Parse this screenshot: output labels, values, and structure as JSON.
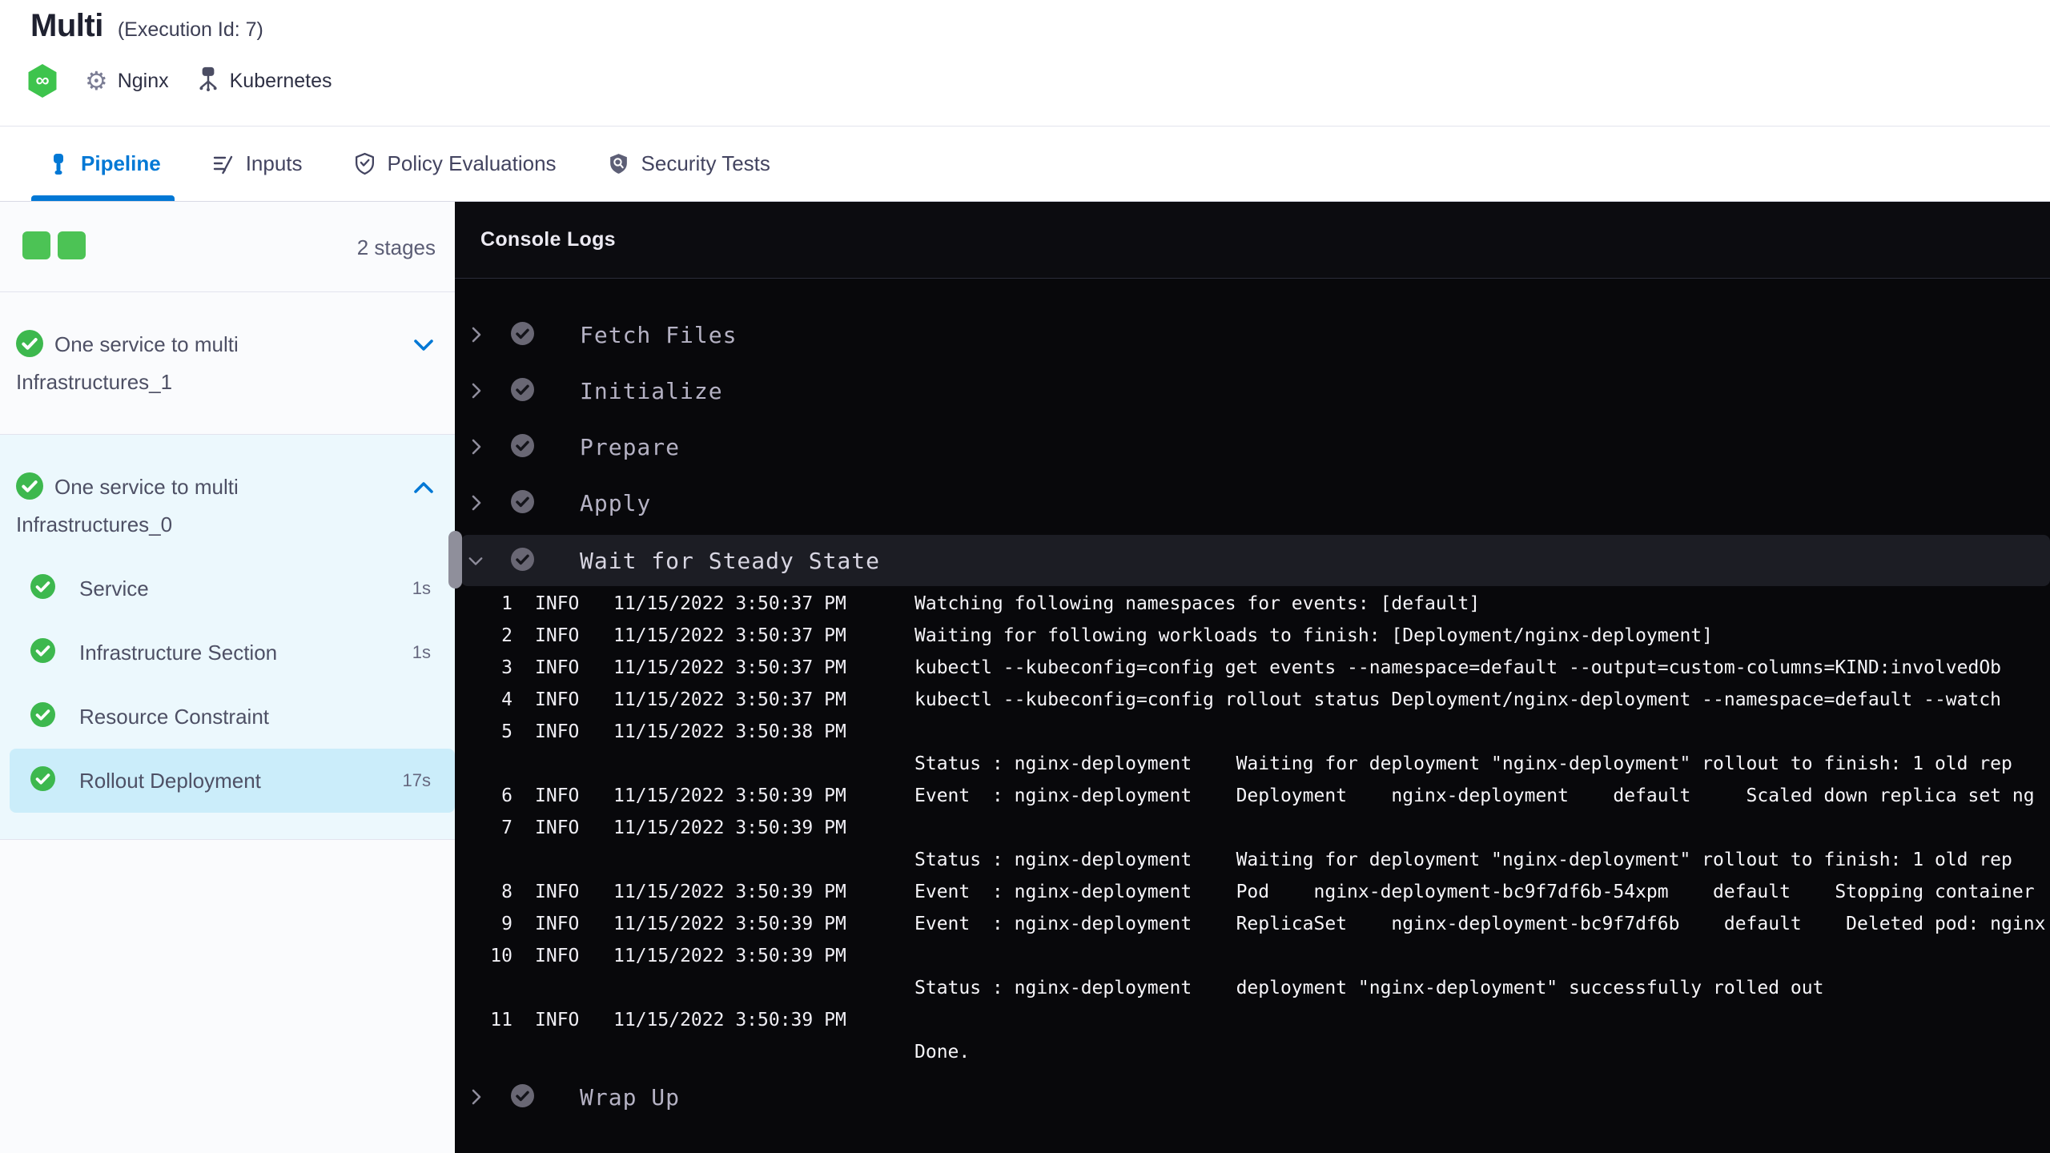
{
  "header": {
    "title": "Multi",
    "execution_label": "(Execution Id: 7)",
    "service_tag": "Nginx",
    "infra_tag": "Kubernetes"
  },
  "tabs": [
    {
      "label": "Pipeline",
      "icon": "pipeline-icon",
      "active": true
    },
    {
      "label": "Inputs",
      "icon": "inputs-icon",
      "active": false
    },
    {
      "label": "Policy Evaluations",
      "icon": "policy-shield-icon",
      "active": false
    },
    {
      "label": "Security Tests",
      "icon": "security-shield-icon",
      "active": false
    }
  ],
  "sidebar": {
    "stage_count_label": "2 stages",
    "stages": [
      {
        "name": "One service to multi Infrastructures_1",
        "status": "success",
        "expanded": false
      },
      {
        "name": "One service to multi Infrastructures_0",
        "status": "success",
        "expanded": true,
        "steps": [
          {
            "name": "Service",
            "duration": "1s",
            "status": "success",
            "selected": false
          },
          {
            "name": "Infrastructure Section",
            "duration": "1s",
            "status": "success",
            "selected": false
          },
          {
            "name": "Resource Constraint",
            "duration": "",
            "status": "success",
            "selected": false
          },
          {
            "name": "Rollout Deployment",
            "duration": "17s",
            "status": "success",
            "selected": true
          }
        ]
      }
    ]
  },
  "console": {
    "title": "Console Logs",
    "steps": [
      {
        "name": "Fetch Files",
        "state": "collapsed",
        "status": "success"
      },
      {
        "name": "Initialize",
        "state": "collapsed",
        "status": "success"
      },
      {
        "name": "Prepare",
        "state": "collapsed",
        "status": "success"
      },
      {
        "name": "Apply",
        "state": "collapsed",
        "status": "success"
      },
      {
        "name": "Wait for Steady State",
        "state": "expanded",
        "status": "success"
      },
      {
        "name": "Wrap Up",
        "state": "collapsed",
        "status": "success"
      }
    ],
    "logs": [
      {
        "num": "1",
        "level": "INFO",
        "time": "11/15/2022 3:50:37 PM",
        "msg": "Watching following namespaces for events: [default]"
      },
      {
        "num": "2",
        "level": "INFO",
        "time": "11/15/2022 3:50:37 PM",
        "msg": "Waiting for following workloads to finish: [Deployment/nginx-deployment]"
      },
      {
        "num": "3",
        "level": "INFO",
        "time": "11/15/2022 3:50:37 PM",
        "msg": "kubectl --kubeconfig=config get events --namespace=default --output=custom-columns=KIND:involvedOb"
      },
      {
        "num": "4",
        "level": "INFO",
        "time": "11/15/2022 3:50:37 PM",
        "msg": "kubectl --kubeconfig=config rollout status Deployment/nginx-deployment --namespace=default --watch"
      },
      {
        "num": "5",
        "level": "INFO",
        "time": "11/15/2022 3:50:38 PM",
        "msg": ""
      },
      {
        "num": "",
        "level": "",
        "time": "",
        "msg": "Status : nginx-deployment    Waiting for deployment \"nginx-deployment\" rollout to finish: 1 old rep"
      },
      {
        "num": "6",
        "level": "INFO",
        "time": "11/15/2022 3:50:39 PM",
        "msg": "Event  : nginx-deployment    Deployment    nginx-deployment    default     Scaled down replica set ng"
      },
      {
        "num": "7",
        "level": "INFO",
        "time": "11/15/2022 3:50:39 PM",
        "msg": ""
      },
      {
        "num": "",
        "level": "",
        "time": "",
        "msg": "Status : nginx-deployment    Waiting for deployment \"nginx-deployment\" rollout to finish: 1 old rep"
      },
      {
        "num": "8",
        "level": "INFO",
        "time": "11/15/2022 3:50:39 PM",
        "msg": "Event  : nginx-deployment    Pod    nginx-deployment-bc9f7df6b-54xpm    default    Stopping container"
      },
      {
        "num": "9",
        "level": "INFO",
        "time": "11/15/2022 3:50:39 PM",
        "msg": "Event  : nginx-deployment    ReplicaSet    nginx-deployment-bc9f7df6b    default    Deleted pod: nginx"
      },
      {
        "num": "10",
        "level": "INFO",
        "time": "11/15/2022 3:50:39 PM",
        "msg": ""
      },
      {
        "num": "",
        "level": "",
        "time": "",
        "msg": "Status : nginx-deployment    deployment \"nginx-deployment\" successfully rolled out"
      },
      {
        "num": "11",
        "level": "INFO",
        "time": "11/15/2022 3:50:39 PM",
        "msg": ""
      },
      {
        "num": "",
        "level": "",
        "time": "",
        "msg": "Done."
      }
    ]
  },
  "colors": {
    "accent_blue": "#0278d5",
    "success_green": "#4cc355",
    "stage_section_bg": "#ecf8fd",
    "selected_step_bg": "#cbedfa",
    "console_bg": "#08080b",
    "active_log_step_bg": "#1c1d24"
  }
}
